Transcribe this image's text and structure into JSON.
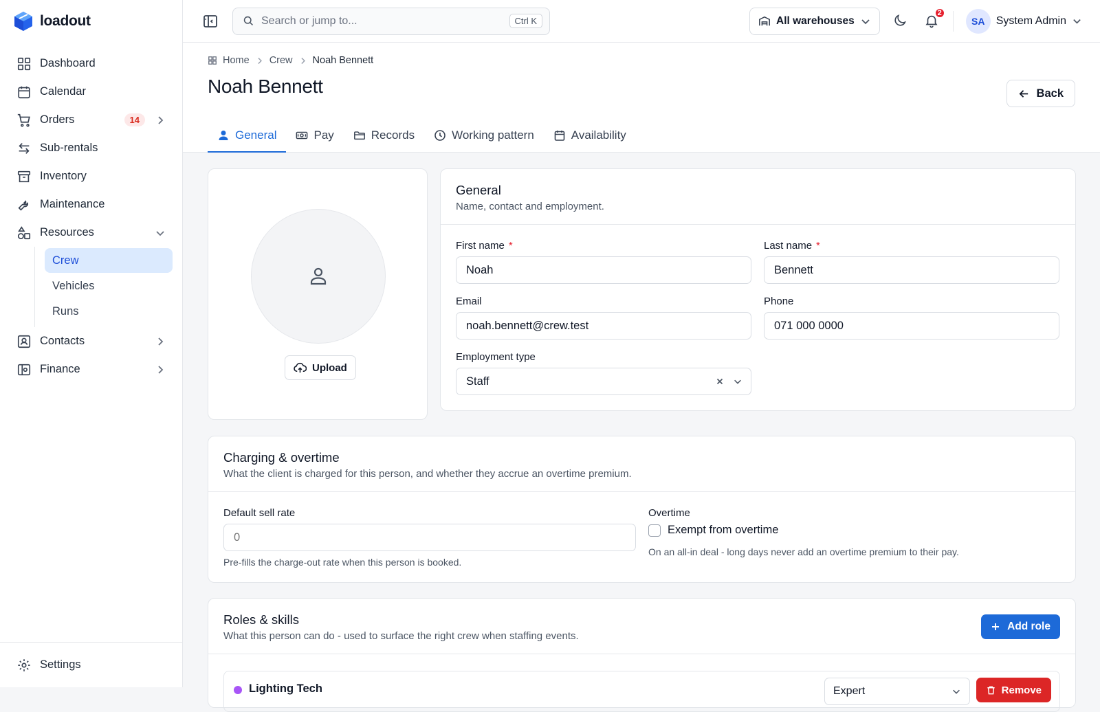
{
  "app": {
    "name": "loadout"
  },
  "sidebar": {
    "items": [
      {
        "label": "Dashboard"
      },
      {
        "label": "Calendar"
      },
      {
        "label": "Orders",
        "badge": "14"
      },
      {
        "label": "Sub-rentals"
      },
      {
        "label": "Inventory"
      },
      {
        "label": "Maintenance"
      },
      {
        "label": "Resources"
      },
      {
        "label": "Contacts"
      },
      {
        "label": "Finance"
      }
    ],
    "resources_sub": [
      {
        "label": "Crew",
        "active": true
      },
      {
        "label": "Vehicles"
      },
      {
        "label": "Runs"
      }
    ],
    "settings_label": "Settings"
  },
  "topbar": {
    "search_placeholder": "Search or jump to...",
    "search_shortcut": "Ctrl K",
    "warehouse": "All warehouses",
    "notifications_count": "2",
    "user_initials": "SA",
    "user_name": "System Admin"
  },
  "breadcrumb": [
    "Home",
    "Crew",
    "Noah Bennett"
  ],
  "page": {
    "title": "Noah Bennett",
    "back_label": "Back"
  },
  "tabs": [
    "General",
    "Pay",
    "Records",
    "Working pattern",
    "Availability"
  ],
  "photo": {
    "upload_label": "Upload"
  },
  "general": {
    "title": "General",
    "subtitle": "Name, contact and employment.",
    "first_name_label": "First name",
    "first_name": "Noah",
    "last_name_label": "Last name",
    "last_name": "Bennett",
    "email_label": "Email",
    "email": "noah.bennett@crew.test",
    "phone_label": "Phone",
    "phone": "071 000 0000",
    "employment_label": "Employment type",
    "employment": "Staff",
    "required_mark": "*"
  },
  "charging": {
    "title": "Charging & overtime",
    "subtitle": "What the client is charged for this person, and whether they accrue an overtime premium.",
    "sell_rate_label": "Default sell rate",
    "sell_rate_placeholder": "0",
    "sell_rate_help": "Pre-fills the charge-out rate when this person is booked.",
    "overtime_label": "Overtime",
    "exempt_label": "Exempt from overtime",
    "exempt_checked": false,
    "overtime_help": "On an all-in deal - long days never add an overtime premium to their pay."
  },
  "roles": {
    "title": "Roles & skills",
    "subtitle": "What this person can do - used to surface the right crew when staffing events.",
    "add_label": "Add role",
    "items": [
      {
        "name": "Lighting Tech",
        "level": "Expert",
        "remove_label": "Remove",
        "color": "#a855f7"
      }
    ]
  },
  "colors": {
    "accent": "#1d6ad8",
    "danger": "#dc2626"
  }
}
